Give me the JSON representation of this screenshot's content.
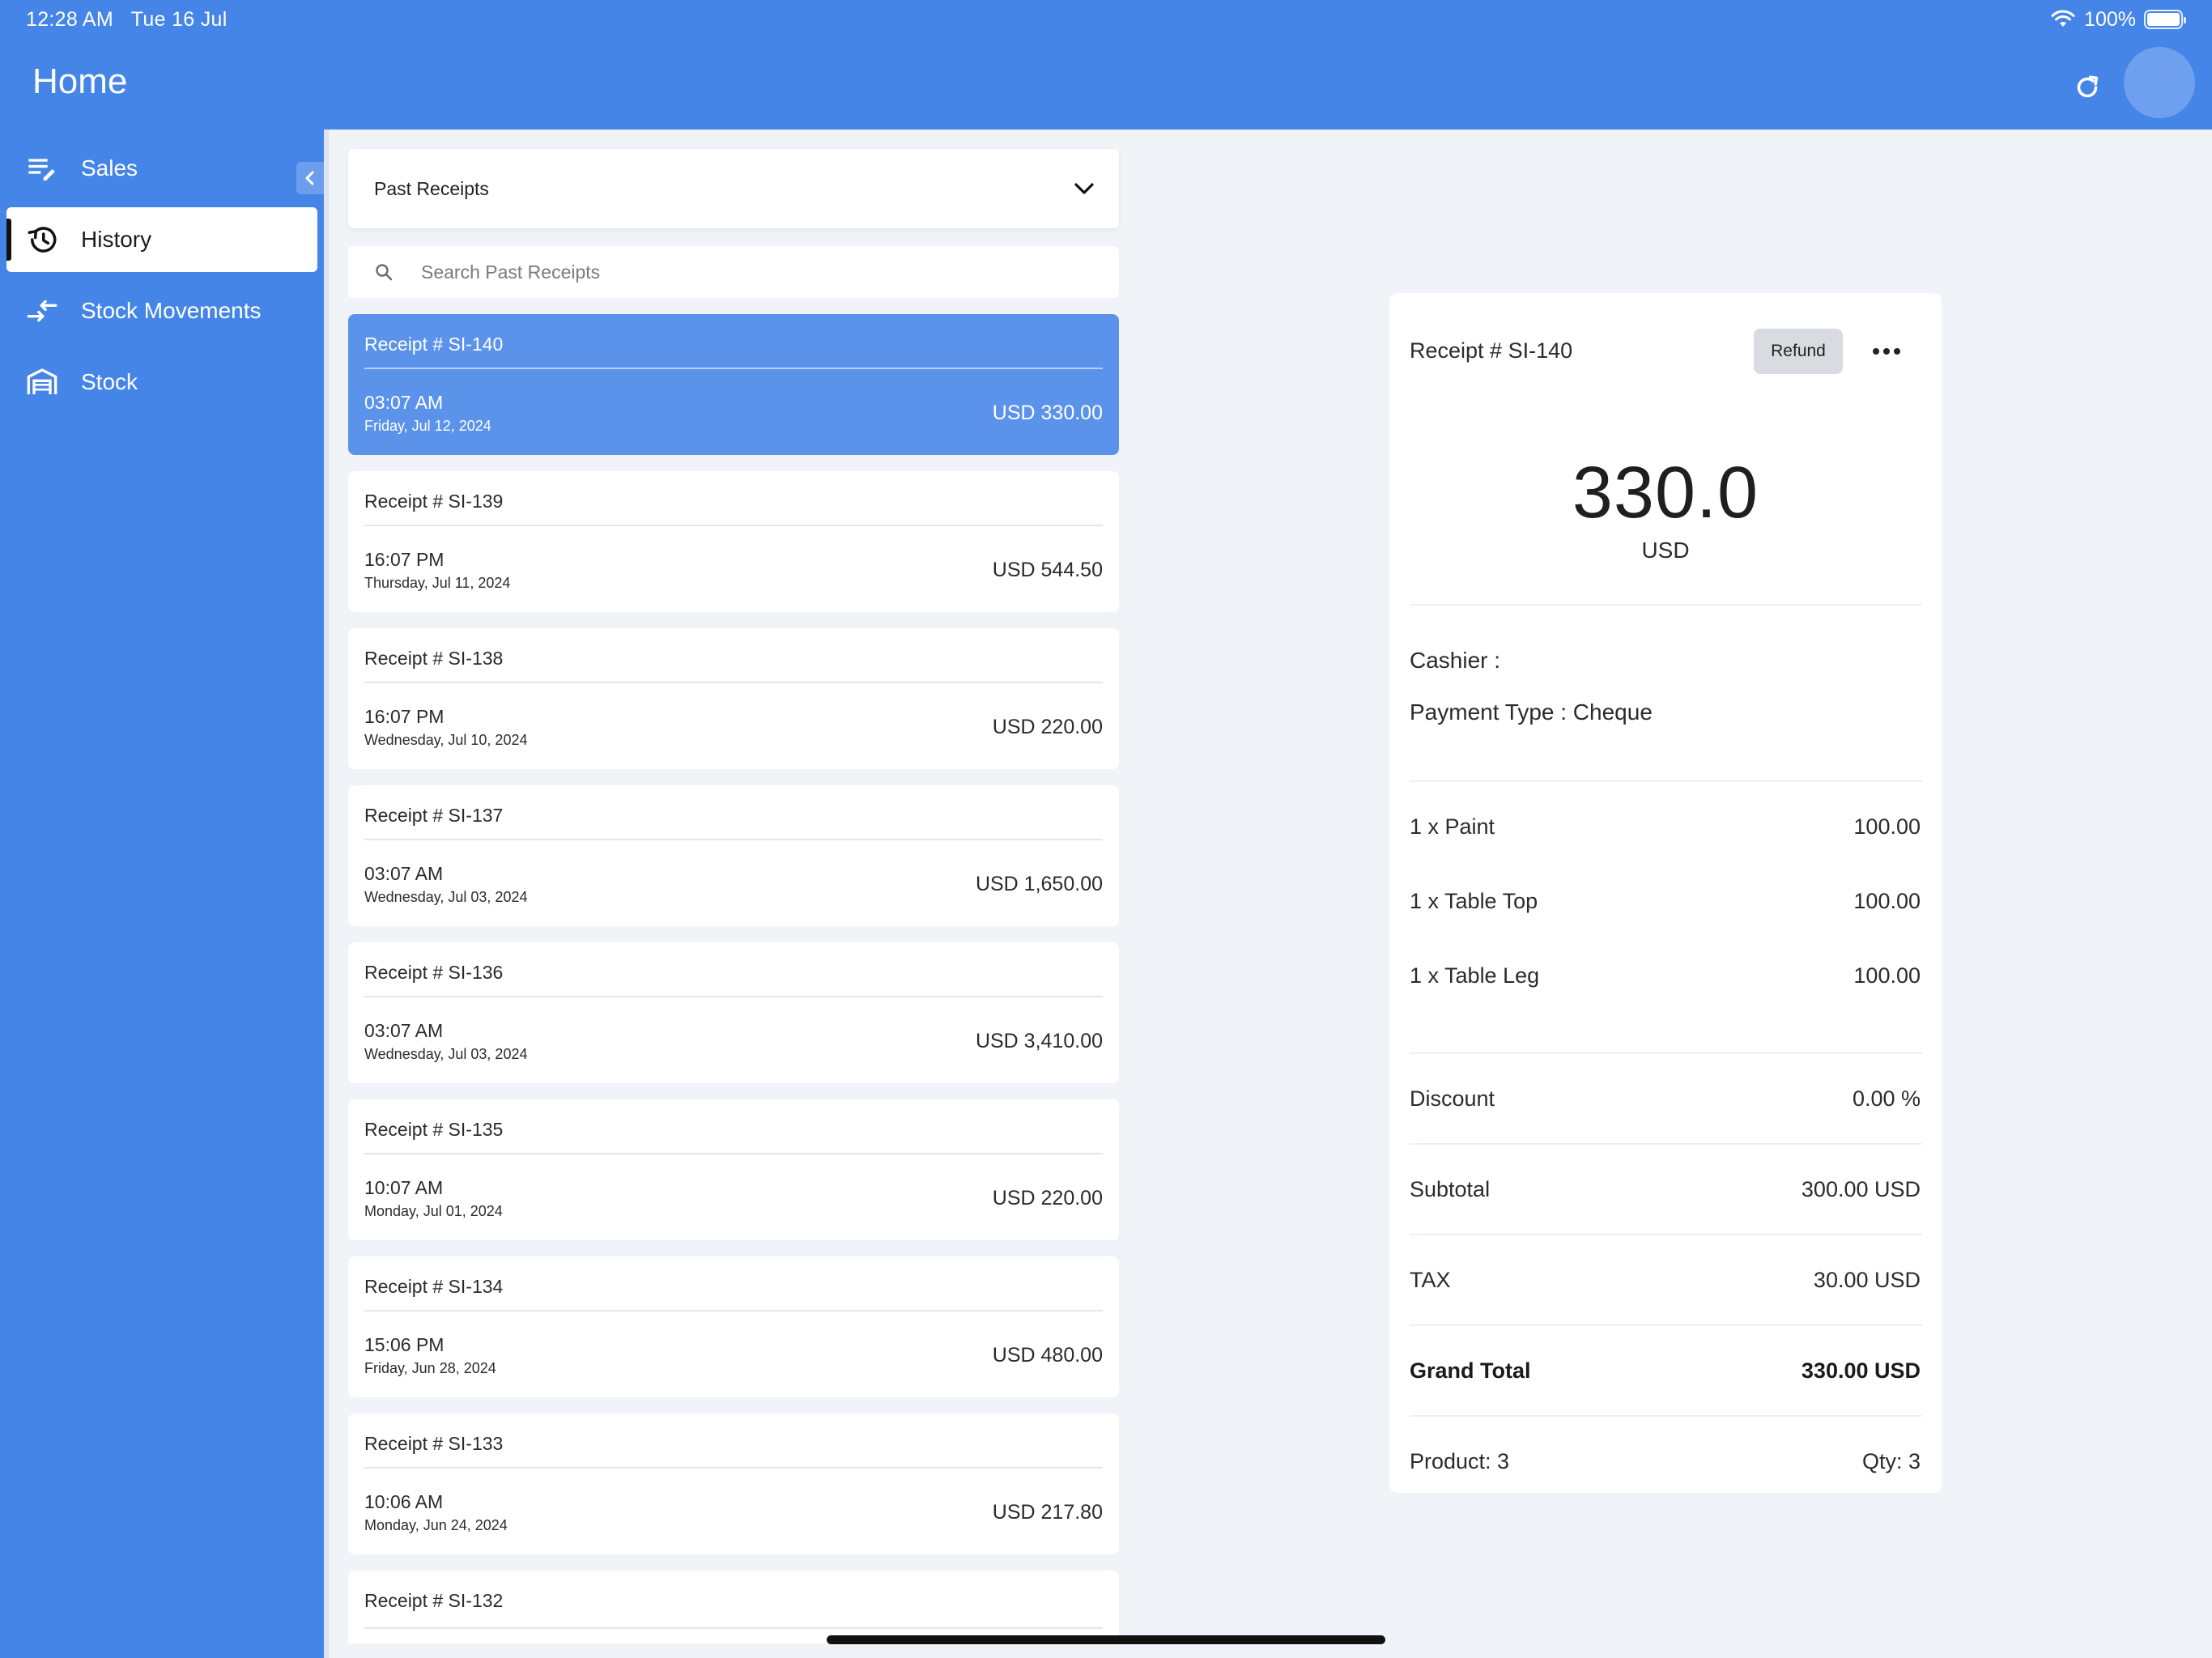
{
  "status_bar": {
    "time": "12:28 AM",
    "date": "Tue 16 Jul",
    "battery": "100%",
    "icons": [
      "wifi-icon",
      "battery-icon"
    ]
  },
  "header": {
    "title": "Home",
    "refresh_icon": "refresh-icon"
  },
  "sidebar": {
    "items": [
      {
        "label": "Sales",
        "icon": "edit-list-icon",
        "active": false
      },
      {
        "label": "History",
        "icon": "history-icon",
        "active": true
      },
      {
        "label": "Stock Movements",
        "icon": "transfer-arrows-icon",
        "active": false
      },
      {
        "label": "Stock",
        "icon": "warehouse-icon",
        "active": false
      }
    ]
  },
  "list": {
    "dropdown_label": "Past Receipts",
    "search_placeholder": "Search Past Receipts",
    "receipts": [
      {
        "number": "Receipt # SI-140",
        "time": "03:07 AM",
        "date": "Friday, Jul 12, 2024",
        "amount": "USD 330.00",
        "selected": true
      },
      {
        "number": "Receipt # SI-139",
        "time": "16:07 PM",
        "date": "Thursday, Jul 11, 2024",
        "amount": "USD 544.50"
      },
      {
        "number": "Receipt # SI-138",
        "time": "16:07 PM",
        "date": "Wednesday, Jul 10, 2024",
        "amount": "USD 220.00"
      },
      {
        "number": "Receipt # SI-137",
        "time": "03:07 AM",
        "date": "Wednesday, Jul 03, 2024",
        "amount": "USD 1,650.00"
      },
      {
        "number": "Receipt # SI-136",
        "time": "03:07 AM",
        "date": "Wednesday, Jul 03, 2024",
        "amount": "USD 3,410.00"
      },
      {
        "number": "Receipt # SI-135",
        "time": "10:07 AM",
        "date": "Monday, Jul 01, 2024",
        "amount": "USD 220.00"
      },
      {
        "number": "Receipt # SI-134",
        "time": "15:06 PM",
        "date": "Friday, Jun 28, 2024",
        "amount": "USD 480.00"
      },
      {
        "number": "Receipt # SI-133",
        "time": "10:06 AM",
        "date": "Monday, Jun 24, 2024",
        "amount": "USD 217.80"
      },
      {
        "number": "Receipt # SI-132"
      }
    ]
  },
  "detail": {
    "receipt_number": "Receipt # SI-140",
    "refund_label": "Refund",
    "amount": "330.0",
    "currency": "USD",
    "cashier": "Cashier :",
    "payment_type": "Payment Type : Cheque",
    "items": [
      {
        "name": "1 x Paint",
        "price": "100.00"
      },
      {
        "name": "1 x Table Top",
        "price": "100.00"
      },
      {
        "name": "1 x Table Leg",
        "price": "100.00"
      }
    ],
    "discount": {
      "label": "Discount",
      "value": "0.00 %"
    },
    "subtotal": {
      "label": "Subtotal",
      "value": "300.00 USD"
    },
    "tax": {
      "label": "TAX",
      "value": "30.00 USD"
    },
    "grand_total": {
      "label": "Grand Total",
      "value": "330.00 USD"
    },
    "product_count": "Product: 3",
    "qty_count": "Qty: 3"
  },
  "colors": {
    "primary": "#4585e8",
    "selected_card": "#5b93ea",
    "background": "#f0f3f8"
  }
}
